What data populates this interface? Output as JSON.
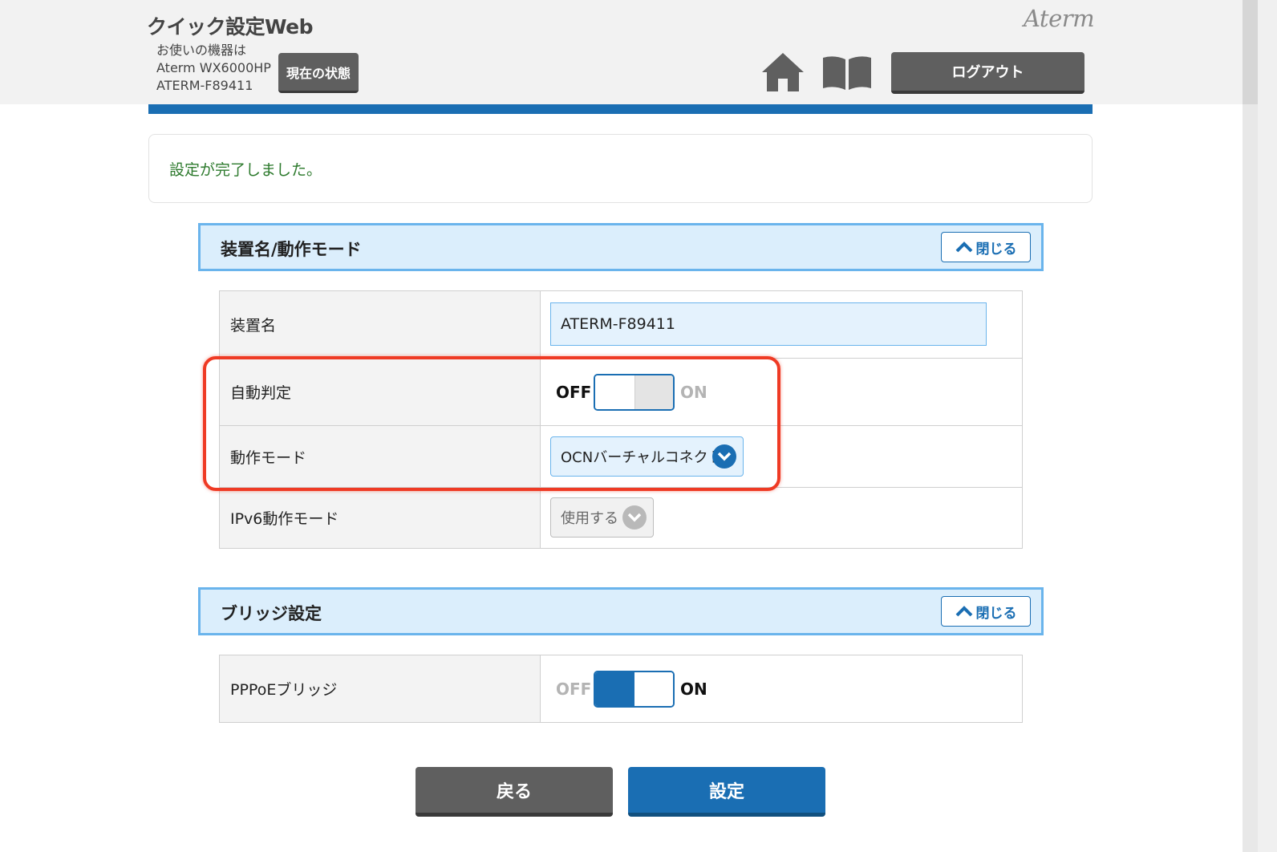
{
  "header": {
    "app_title": "クイック設定Web",
    "device_info": [
      "お使いの機器は",
      "Aterm WX6000HP",
      "ATERM-F89411"
    ],
    "status_button": "現在の状態",
    "brand": "Aterm",
    "logout_button": "ログアウト"
  },
  "message": {
    "text": "設定が完了しました。"
  },
  "section_device": {
    "title": "装置名/動作モード",
    "close_label": "閉じる",
    "rows": [
      {
        "label": "装置名",
        "value": "ATERM-F89411"
      },
      {
        "label": "自動判定",
        "off": "OFF",
        "on": "ON",
        "state": "OFF"
      },
      {
        "label": "動作モード",
        "value": "OCNバーチャルコネクト"
      },
      {
        "label": "IPv6動作モード",
        "value": "使用する"
      }
    ]
  },
  "section_bridge": {
    "title": "ブリッジ設定",
    "close_label": "閉じる",
    "rows": [
      {
        "label": "PPPoEブリッジ",
        "off": "OFF",
        "on": "ON",
        "state": "ON"
      }
    ]
  },
  "buttons": {
    "back": "戻る",
    "save": "設定"
  },
  "colors": {
    "accent": "#1a6eb3",
    "success_text": "#2d7a2d",
    "highlight": "#ef3a24"
  }
}
